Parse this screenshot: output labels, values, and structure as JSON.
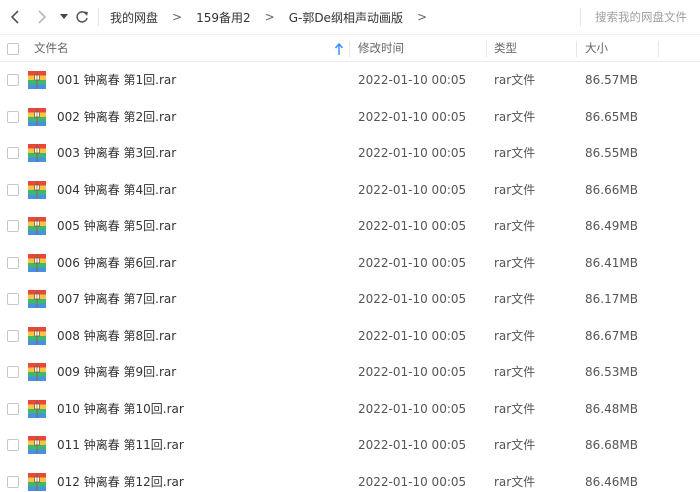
{
  "nav": {
    "back_icon": "chevron-left-icon",
    "forward_icon": "chevron-right-icon",
    "dropdown_icon": "caret-down-icon",
    "refresh_icon": "refresh-icon"
  },
  "breadcrumb": {
    "items": [
      "我的网盘",
      "159备用2",
      "G-郭De纲相声动画版"
    ],
    "separator": ">"
  },
  "search": {
    "placeholder": "搜索我的网盘文件"
  },
  "columns": {
    "name": "文件名",
    "mtime": "修改时间",
    "type": "类型",
    "size": "大小",
    "sort_icon": "sort-up-arrow-icon"
  },
  "colors": {
    "accent": "#2f8cff",
    "icon_red": "#e8483c",
    "icon_yellow": "#f7c443",
    "icon_green": "#3fb86f",
    "icon_blue": "#4a90e2"
  },
  "files": [
    {
      "name": "001 钟离春 第1回.rar",
      "mtime": "2022-01-10 00:05",
      "type": "rar文件",
      "size": "86.57MB"
    },
    {
      "name": "002 钟离春 第2回.rar",
      "mtime": "2022-01-10 00:05",
      "type": "rar文件",
      "size": "86.65MB"
    },
    {
      "name": "003 钟离春 第3回.rar",
      "mtime": "2022-01-10 00:05",
      "type": "rar文件",
      "size": "86.55MB"
    },
    {
      "name": "004 钟离春 第4回.rar",
      "mtime": "2022-01-10 00:05",
      "type": "rar文件",
      "size": "86.66MB"
    },
    {
      "name": "005 钟离春 第5回.rar",
      "mtime": "2022-01-10 00:05",
      "type": "rar文件",
      "size": "86.49MB"
    },
    {
      "name": "006 钟离春 第6回.rar",
      "mtime": "2022-01-10 00:05",
      "type": "rar文件",
      "size": "86.41MB"
    },
    {
      "name": "007 钟离春 第7回.rar",
      "mtime": "2022-01-10 00:05",
      "type": "rar文件",
      "size": "86.17MB"
    },
    {
      "name": "008 钟离春 第8回.rar",
      "mtime": "2022-01-10 00:05",
      "type": "rar文件",
      "size": "86.67MB"
    },
    {
      "name": "009 钟离春 第9回.rar",
      "mtime": "2022-01-10 00:05",
      "type": "rar文件",
      "size": "86.53MB"
    },
    {
      "name": "010 钟离春 第10回.rar",
      "mtime": "2022-01-10 00:05",
      "type": "rar文件",
      "size": "86.48MB"
    },
    {
      "name": "011 钟离春 第11回.rar",
      "mtime": "2022-01-10 00:05",
      "type": "rar文件",
      "size": "86.68MB"
    },
    {
      "name": "012 钟离春 第12回.rar",
      "mtime": "2022-01-10 00:05",
      "type": "rar文件",
      "size": "86.46MB"
    }
  ]
}
